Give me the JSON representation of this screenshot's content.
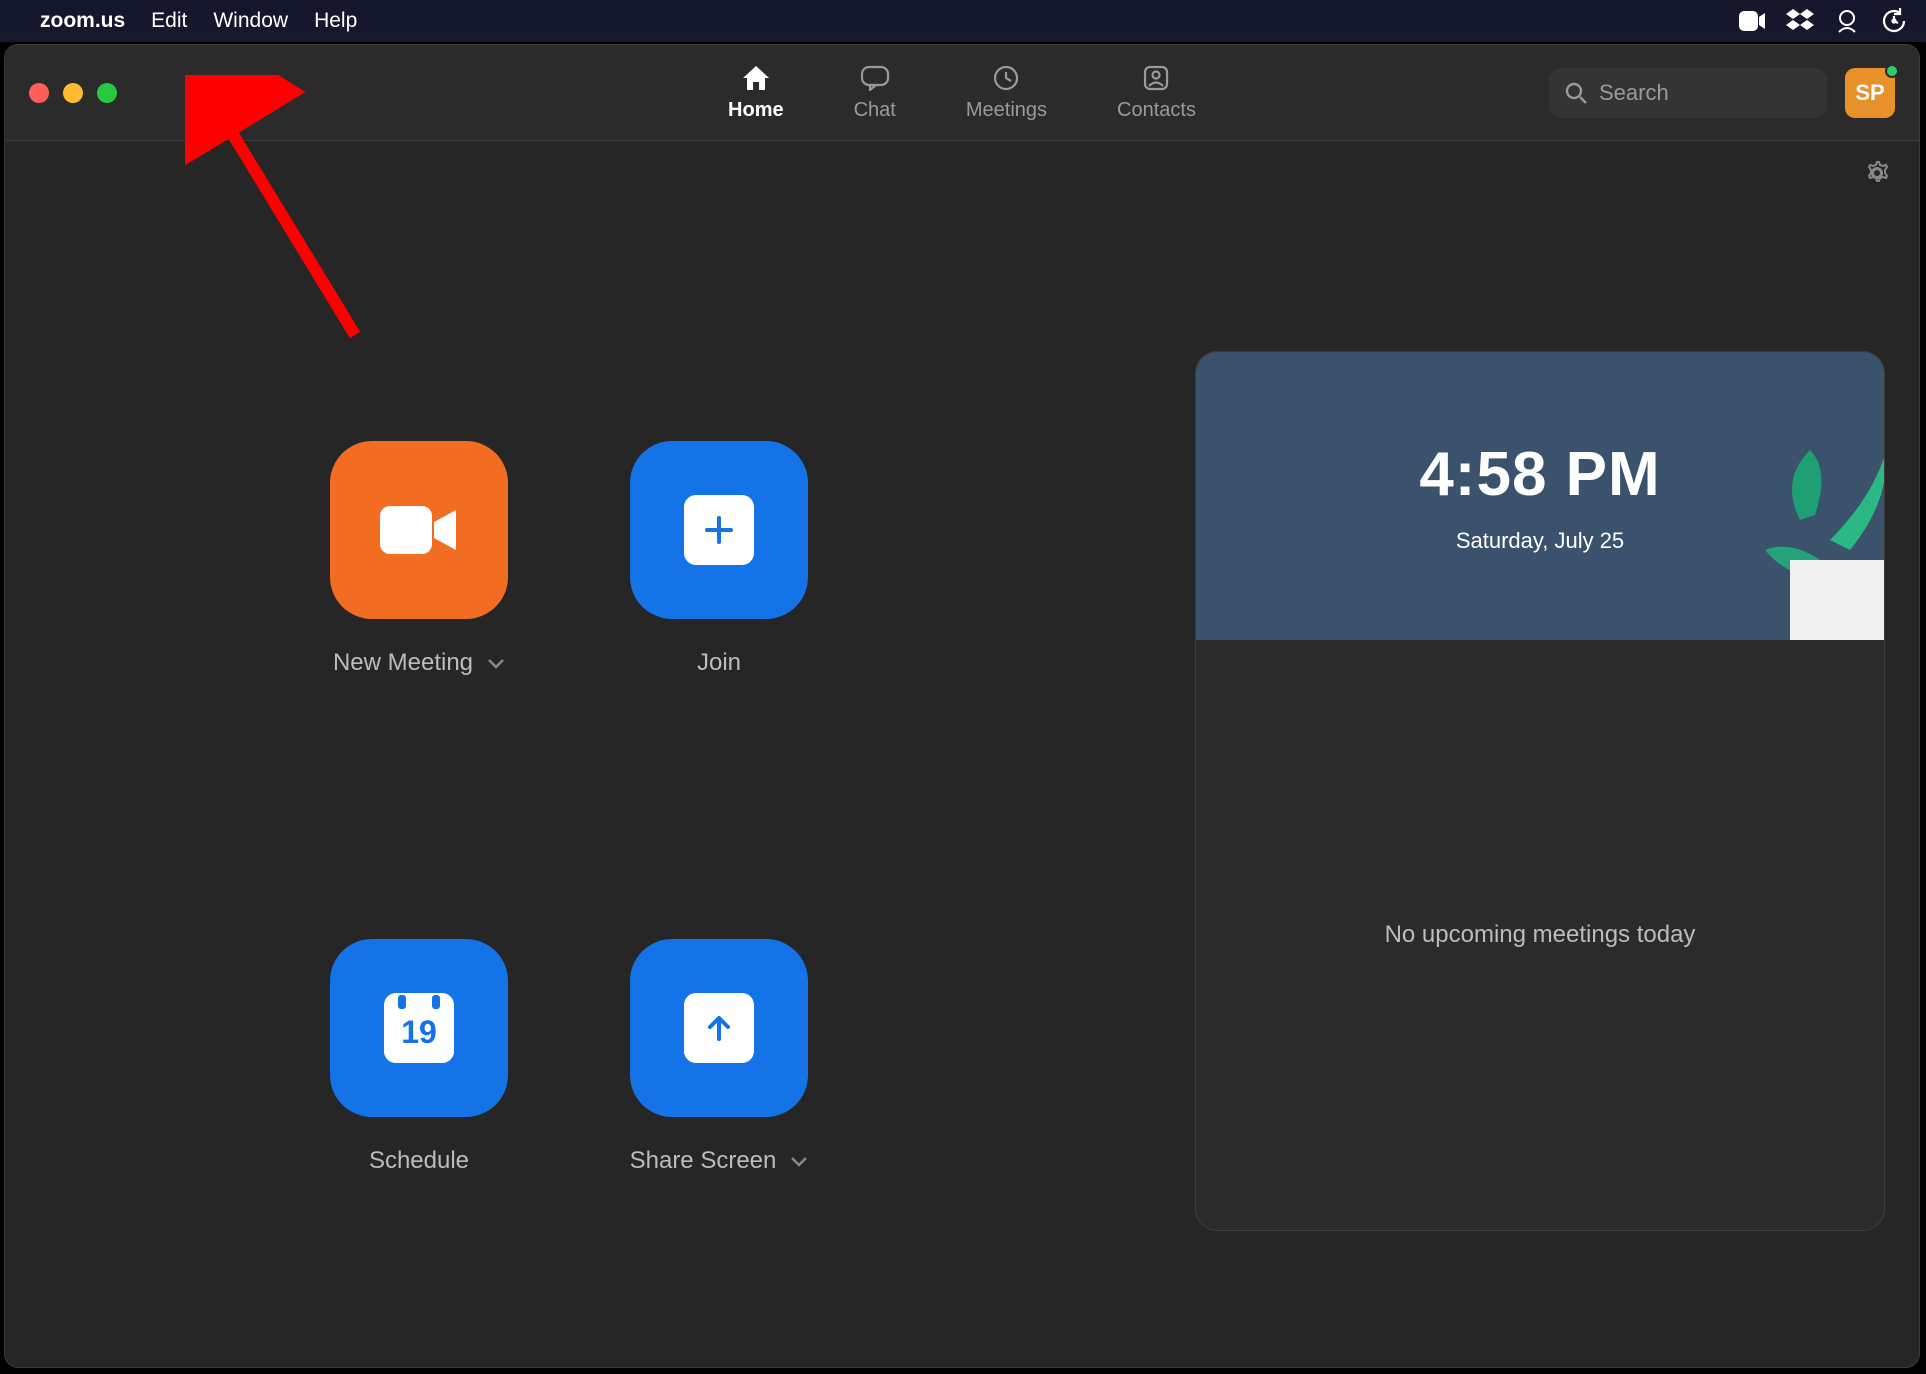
{
  "menubar": {
    "app_name": "zoom.us",
    "items": [
      "Edit",
      "Window",
      "Help"
    ]
  },
  "toolbar": {
    "tabs": [
      {
        "label": "Home",
        "active": true
      },
      {
        "label": "Chat",
        "active": false
      },
      {
        "label": "Meetings",
        "active": false
      },
      {
        "label": "Contacts",
        "active": false
      }
    ],
    "search_placeholder": "Search",
    "avatar_initials": "SP"
  },
  "actions": {
    "new_meeting": "New Meeting",
    "join": "Join",
    "schedule": "Schedule",
    "share_screen": "Share Screen",
    "calendar_day": "19"
  },
  "calendar": {
    "time": "4:58 PM",
    "date": "Saturday, July 25",
    "empty_message": "No upcoming meetings today"
  }
}
